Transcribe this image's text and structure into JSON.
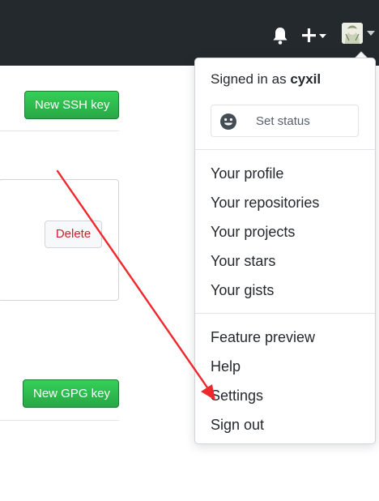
{
  "header": {
    "notifications_icon": "bell-icon",
    "create_icon": "plus-icon",
    "avatar_alt": "avatar"
  },
  "ssh": {
    "new_button": "New SSH key",
    "delete_button": "Delete"
  },
  "gpg": {
    "new_button": "New GPG key"
  },
  "dropdown": {
    "signed_in_prefix": "Signed in as",
    "username": "cyxil",
    "set_status": "Set status",
    "items_group1": [
      "Your profile",
      "Your repositories",
      "Your projects",
      "Your stars",
      "Your gists"
    ],
    "items_group2": [
      "Feature preview",
      "Help",
      "Settings",
      "Sign out"
    ]
  },
  "colors": {
    "header_bg": "#24292e",
    "green_button": "#28a745",
    "delete_text": "#cb2431",
    "annotation_arrow": "#f0282d"
  }
}
